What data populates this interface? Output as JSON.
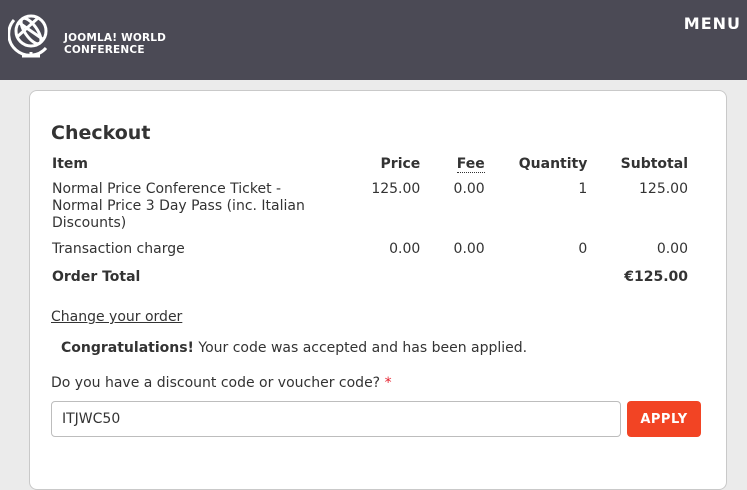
{
  "header": {
    "logo_line1": "JOOMLA! WORLD",
    "logo_line2": "CONFERENCE",
    "menu_label": "MENU",
    "background": "#4b4a55"
  },
  "checkout": {
    "title": "Checkout",
    "columns": {
      "item": "Item",
      "price": "Price",
      "fee": "Fee",
      "quantity": "Quantity",
      "subtotal": "Subtotal"
    },
    "rows": [
      {
        "item": "Normal Price Conference Ticket - Normal Price 3 Day Pass (inc. Italian Discounts)",
        "price": "125.00",
        "fee": "0.00",
        "quantity": "1",
        "subtotal": "125.00"
      },
      {
        "item": "Transaction charge",
        "price": "0.00",
        "fee": "0.00",
        "quantity": "0",
        "subtotal": "0.00"
      }
    ],
    "total_label": "Order Total",
    "total_value": "€125.00",
    "change_order_link": "Change your order",
    "congrats_bold": "Congratulations!",
    "congrats_text": " Your code was accepted and has been applied.",
    "discount_label": "Do you have a discount code or voucher code?",
    "required_marker": "*",
    "discount_code_value": "ITJWC50",
    "apply_label": "APPLY",
    "accent_color": "#f24424"
  }
}
